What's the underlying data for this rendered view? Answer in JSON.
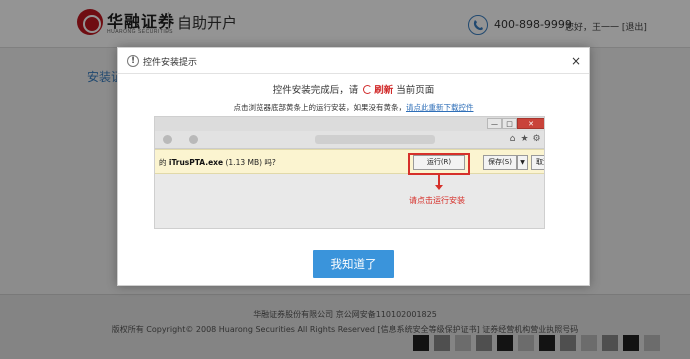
{
  "header": {
    "brand_name": "华融证券",
    "brand_sub": "HUARONG SECURITIES",
    "title": "自助开户",
    "phone": "400-898-9999",
    "greeting": "您好，王一一 [退出]"
  },
  "background": {
    "section_label": "安装证"
  },
  "footer": {
    "line1": "华融证券股份有限公司    京公网安备110102001825",
    "line2": "版权所有 Copyright© 2008 Huarong Securities All Rights Reserved [信息系统安全等级保护证书] 证券经营机构营业执照号码"
  },
  "dialog": {
    "title": "控件安装提示",
    "close": "×",
    "warn_icon": "!",
    "line1_prefix": "控件安装完成后，请",
    "line1_action": "刷新",
    "line1_suffix": "当前页面",
    "line2_text": "点击浏览器底部黄条上的运行安装，如果没有黄条，",
    "line2_link": "请点此重新下载控件",
    "ok_button": "我知道了"
  },
  "screenshot": {
    "win_min": "—",
    "win_max": "□",
    "win_close": "✕",
    "download_prefix": "的",
    "download_file": "iTrusPTA.exe",
    "download_suffix": "(1.13 MB) 吗?",
    "run_button": "运行(R)",
    "save_button": "保存(S)",
    "save_arrow": "▼",
    "cancel_button": "取消",
    "hint": "请点击运行安装"
  },
  "icons": {
    "warn": "warning-icon",
    "close": "close-icon",
    "refresh": "refresh-icon",
    "phone": "phone-icon",
    "logo": "logo-icon"
  },
  "colors": {
    "accent_red": "#d6302a",
    "button_blue": "#3a94db",
    "link_blue": "#2f6fb8",
    "brand_red": "#c0171f"
  }
}
